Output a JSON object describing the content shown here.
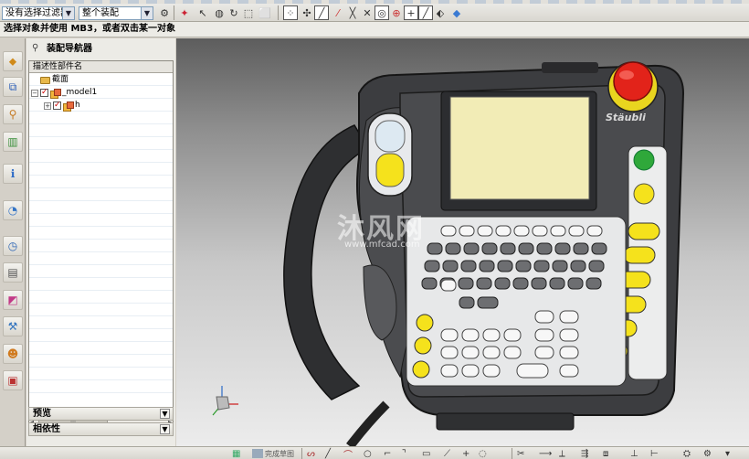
{
  "toolbar": {
    "selection_filter": "没有选择过滤器",
    "assembly_scope": "整个装配"
  },
  "status": {
    "prompt": "选择对象并使用 MB3，或者双击某一对象"
  },
  "navigator": {
    "title": "装配导航器",
    "column_header": "描述性部件名",
    "nodes": [
      {
        "label": "截面"
      },
      {
        "label": "_model1"
      },
      {
        "label": "h"
      }
    ],
    "sections": {
      "preview": "预览",
      "dependency": "相依性"
    }
  },
  "viewport": {
    "watermark": "沐风网",
    "watermark_url": "www.mfcad.com",
    "brand": "Stäubli",
    "colors": {
      "body": "#3c3d40",
      "screen": "#f2ecb6",
      "estop": "#e2231a",
      "yellow_key": "#f5e21c",
      "green_key": "#2fa83a"
    }
  },
  "bottom_toolbar": {
    "finish_sketch": "完成草图"
  }
}
